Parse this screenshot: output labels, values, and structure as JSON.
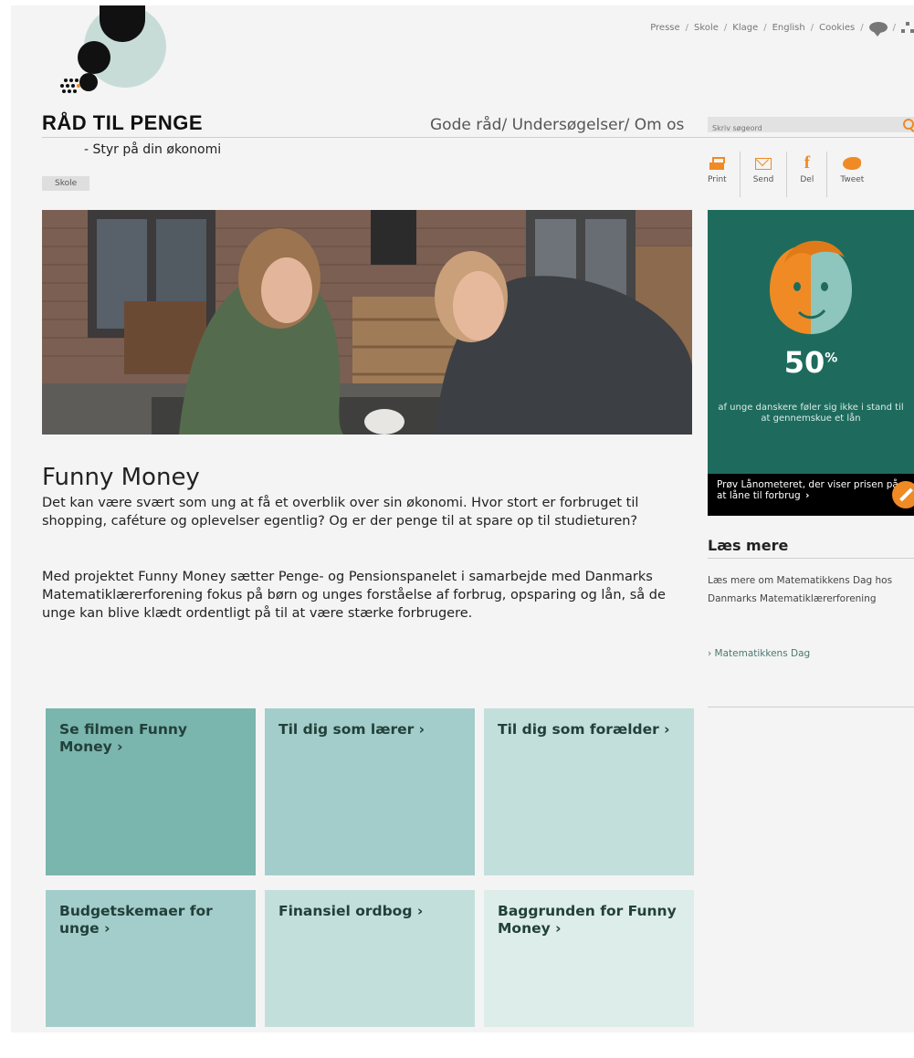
{
  "topnav": {
    "links": [
      "Presse",
      "Skole",
      "Klage",
      "English",
      "Cookies"
    ],
    "separator": "/"
  },
  "logo": {
    "text": "RÅD TIL PENGE"
  },
  "tagline": "- Styr på din økonomi",
  "mainnav": [
    "Gode råd",
    "Undersøgelser",
    "Om os"
  ],
  "search": {
    "placeholder": "Skriv søgeord"
  },
  "breadcrumb": "Skole",
  "share": {
    "print": "Print",
    "send": "Send",
    "share": "Del",
    "tweet": "Tweet"
  },
  "article": {
    "title": "Funny Money",
    "paragraphs": [
      "Det kan være svært som ung at få et overblik over sin økonomi. Hvor stort er forbruget til shopping, caféture og oplevelser egentlig? Og er der penge til at spare op til studieturen?",
      "Med projektet Funny Money sætter Penge- og Pensionspanelet i samarbejde med Danmarks Matematiklærerforening fokus på børn og unges forståelse af forbrug, opsparing og lån, så de unge kan blive klædt ordentligt på til at være stærke forbrugere."
    ]
  },
  "tiles": [
    {
      "label": "Se filmen Funny Money ›",
      "color": "#7ab5ae"
    },
    {
      "label": "Til dig som lærer ›",
      "color": "#a3cdca"
    },
    {
      "label": "Til dig som forælder ›",
      "color": "#c3dfdb"
    },
    {
      "label": "Budgetskemaer for unge ›",
      "color": "#a3cdca"
    },
    {
      "label": "Finansiel ordbog ›",
      "color": "#c3dfdb"
    },
    {
      "label": "Baggrunden for Funny Money ›",
      "color": "#ddede9"
    }
  ],
  "teaser": {
    "percent": "50",
    "percent_sign": "%",
    "claim": "af unge danskere føler sig ikke i stand til at gennemskue et lån",
    "cta": "Prøv Lånometeret, der viser prisen på at låne til forbrug",
    "cta_chevron": "›",
    "colors": {
      "background": "#1e6b5d",
      "face_orange": "#f08a24",
      "face_teal": "#8ec5bd"
    }
  },
  "read_more": {
    "title": "Læs mere",
    "text": "Læs mere om Matematikkens Dag hos Danmarks Matematiklærerforening",
    "link": "› Matematikkens Dag"
  },
  "colors": {
    "accent": "#f08a24",
    "tile_dark": "#7ab5ae"
  }
}
